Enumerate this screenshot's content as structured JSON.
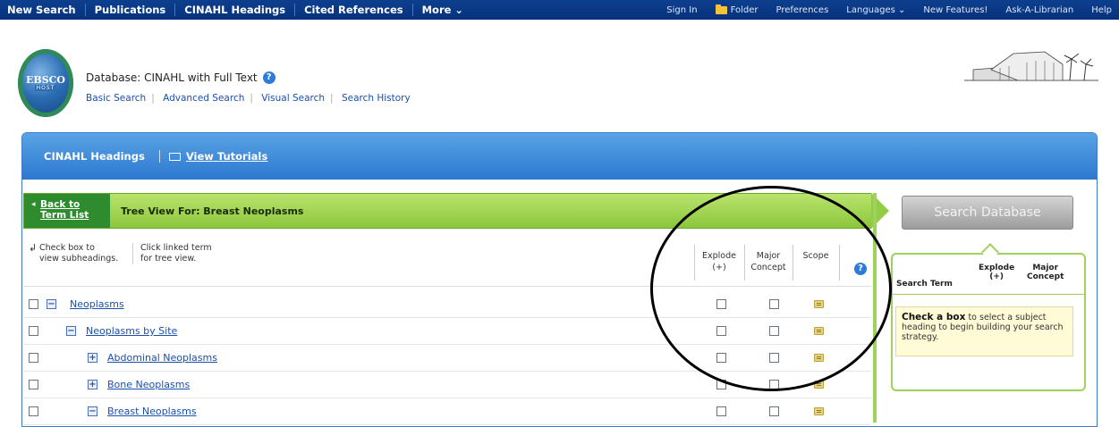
{
  "topnav": {
    "left": [
      "New Search",
      "Publications",
      "CINAHL Headings",
      "Cited References",
      "More ⌄"
    ],
    "right": [
      "Sign In",
      "Folder",
      "Preferences",
      "Languages ⌄",
      "New Features!",
      "Ask-A-Librarian",
      "Help"
    ]
  },
  "header": {
    "logo_line1": "EBSCO",
    "logo_line2": "HOST",
    "database_label": "Database: CINAHL with Full Text",
    "links": [
      "Basic Search",
      "Advanced Search",
      "Visual Search",
      "Search History"
    ]
  },
  "panel": {
    "title": "CINAHL Headings",
    "tutorials": "View Tutorials"
  },
  "tree": {
    "back_line1": "Back to",
    "back_line2": "Term List",
    "title": "Tree View For: Breast Neoplasms",
    "hint_check_1": "Check box to",
    "hint_check_2": "view subheadings.",
    "hint_click_1": "Click linked term",
    "hint_click_2": "for tree view.",
    "col_explode_1": "Explode",
    "col_explode_2": "(+)",
    "col_major_1": "Major",
    "col_major_2": "Concept",
    "col_scope": "Scope",
    "rows": [
      {
        "term": "Neoplasms",
        "toggle": "−"
      },
      {
        "term": "Neoplasms by Site",
        "toggle": "−"
      },
      {
        "term": "Abdominal Neoplasms",
        "toggle": "+"
      },
      {
        "term": "Bone Neoplasms",
        "toggle": "+"
      },
      {
        "term": "Breast Neoplasms",
        "toggle": "−"
      }
    ]
  },
  "right_panel": {
    "search_button": "Search Database",
    "col_search_term": "Search Term",
    "col_explode_1": "Explode",
    "col_explode_2": "(+)",
    "col_major_1": "Major",
    "col_major_2": "Concept",
    "note_bold": "Check a box",
    "note_text": " to select a subject heading to begin building your search strategy."
  },
  "colors": {
    "nav_bg": "#06317c",
    "panel_blue": "#2c78cf",
    "tree_green": "#8cc63c",
    "link": "#1a4fae"
  }
}
